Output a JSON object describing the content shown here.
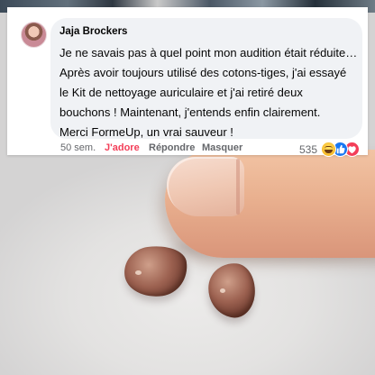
{
  "comment": {
    "author": "Jaja Brockers",
    "text_lines": [
      "Je ne savais pas à quel point mon audition était réduite…",
      "Après avoir toujours utilisé des cotons-tiges, j'ai essayé",
      "le Kit de nettoyage auriculaire et j'ai retiré deux",
      "bouchons ! Maintenant, j'entends enfin clairement.",
      "Merci FormeUp, un vrai sauveur !"
    ]
  },
  "actions": {
    "timestamp": "50 sem.",
    "like_label": "J'adore",
    "reply_label": "Répondre",
    "hide_label": "Masquer"
  },
  "reactions": {
    "count": "535",
    "icons": [
      "haha-icon",
      "like-icon",
      "love-icon"
    ]
  },
  "colors": {
    "bubble": "#f0f2f5",
    "love": "#f33e58",
    "like": "#1877f2",
    "haha": "#f7b928",
    "secondary_text": "#65676b"
  }
}
